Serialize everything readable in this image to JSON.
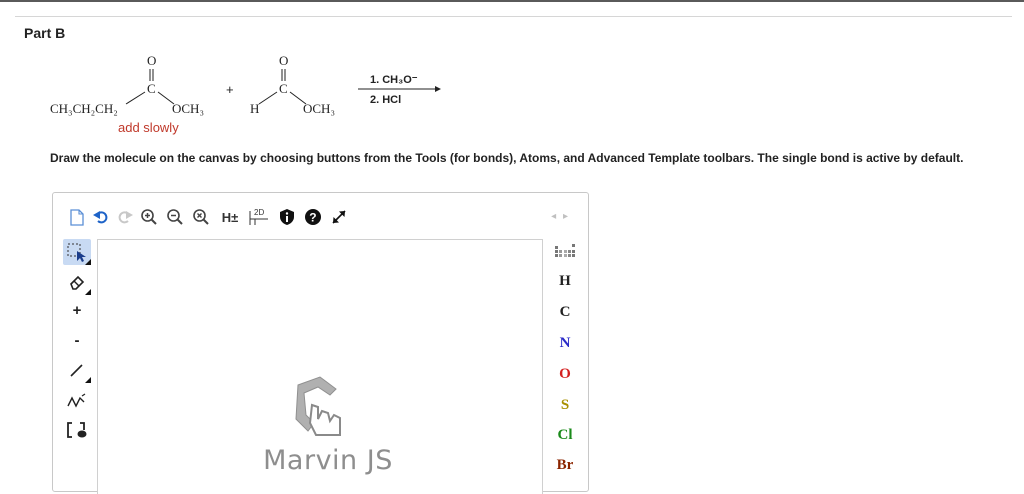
{
  "part": {
    "title": "Part B"
  },
  "reaction": {
    "reactant1": {
      "carbonyl_o": "O",
      "carbonyl_c": "C",
      "alkyl": "CH₃CH₂CH₂",
      "ester_group": "OCH₃"
    },
    "plus": "+",
    "reactant2": {
      "carbonyl_o": "O",
      "carbonyl_c": "C",
      "hydrogen": "H",
      "ester_group": "OCH₃"
    },
    "note": "add slowly",
    "conditions": [
      "1. CH₃O⁻",
      "2. HCl"
    ],
    "note_color": "#c0392b"
  },
  "instructions": "Draw the molecule on the canvas by choosing buttons from the Tools (for bonds), Atoms, and Advanced Template toolbars. The single bond is active by default.",
  "editor": {
    "top_toolbar": {
      "icons": [
        "new-document-icon",
        "undo-icon",
        "redo-icon",
        "zoom-in-icon",
        "zoom-out-icon",
        "zoom-reset-icon",
        "add-hydrogens",
        "clean-2d",
        "info-icon",
        "help-icon",
        "fullscreen-icon"
      ],
      "hydrogens_label": "H±",
      "clean_label": "2D",
      "scroll_arrows": "◂ ▸"
    },
    "left_toolbar": {
      "icons": [
        "selection-icon",
        "eraser-icon",
        "plus-charge",
        "minus-charge",
        "single-bond-icon",
        "chain-icon",
        "bracket-icon"
      ],
      "plus_label": "+",
      "minus_label": "-"
    },
    "canvas": {
      "watermark": "Marvin JS"
    },
    "atoms": [
      {
        "symbol": "H",
        "color": "#222222"
      },
      {
        "symbol": "C",
        "color": "#222222"
      },
      {
        "symbol": "N",
        "color": "#2b2bc8"
      },
      {
        "symbol": "O",
        "color": "#d42020"
      },
      {
        "symbol": "S",
        "color": "#a89000"
      },
      {
        "symbol": "Cl",
        "color": "#1a8a1a"
      },
      {
        "symbol": "Br",
        "color": "#8b2500"
      }
    ]
  }
}
